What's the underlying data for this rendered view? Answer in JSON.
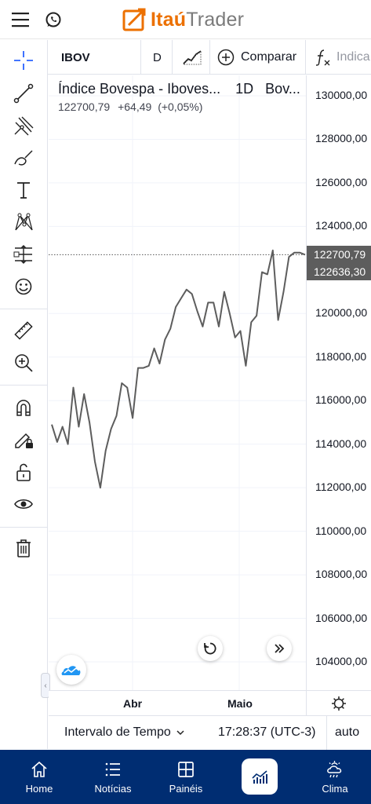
{
  "header": {
    "logo_brand": "Itaú",
    "logo_product": "Trader",
    "brand_color": "#ec7000"
  },
  "chart_toolbar": {
    "symbol": "IBOV",
    "interval": "D",
    "compare_label": "Comparar",
    "indicators_label": "Indica"
  },
  "legend": {
    "title": "Índice Bovespa - Iboves...",
    "interval": "1D",
    "exchange": "Bov...",
    "last": "122700,79",
    "change": "+64,49",
    "change_pct": "(+0,05%)"
  },
  "price_axis": {
    "labels": [
      "130000,00",
      "128000,00",
      "126000,00",
      "124000,00",
      "120000,00",
      "118000,00",
      "116000,00",
      "114000,00",
      "112000,00",
      "110000,00",
      "108000,00",
      "106000,00",
      "104000,00"
    ],
    "last_price_tag": "122700,79",
    "prev_close_tag": "122636,30"
  },
  "time_axis": {
    "labels": [
      "Abr",
      "Maio"
    ]
  },
  "status_bar": {
    "interval_label": "Intervalo de Tempo",
    "clock": "17:28:37 (UTC-3)",
    "scale_mode": "auto"
  },
  "bottom_nav": {
    "items": [
      {
        "label": "Home",
        "icon": "home-icon"
      },
      {
        "label": "Notícias",
        "icon": "news-icon"
      },
      {
        "label": "Painéis",
        "icon": "panels-icon"
      },
      {
        "label": "",
        "icon": "chart-icon",
        "active": true
      },
      {
        "label": "Clima",
        "icon": "weather-icon"
      }
    ],
    "background": "#002d72"
  },
  "chart_data": {
    "type": "line",
    "series": [
      {
        "values": [
          114900,
          114100,
          114800,
          114000,
          116600,
          114800,
          116300,
          115000,
          113200,
          112000,
          113700,
          114700,
          115300,
          116800,
          116600,
          115200,
          117500,
          117500,
          117600,
          118400,
          117700,
          118800,
          119300,
          120300,
          120700,
          121100,
          120900,
          120100,
          119400,
          120500,
          120500,
          119400,
          121000,
          120000,
          118900,
          119200,
          117600,
          119600,
          119900,
          121900,
          121800,
          122900,
          119700,
          121000,
          122600,
          122800,
          122800,
          122700
        ]
      }
    ],
    "x_tick_labels": [
      "Abr",
      "Maio"
    ],
    "ylim": [
      103000,
      131000
    ],
    "last_value": 122700.79,
    "prev_close": 122636.3,
    "line_color": "#5d5d5d",
    "grid": true
  }
}
